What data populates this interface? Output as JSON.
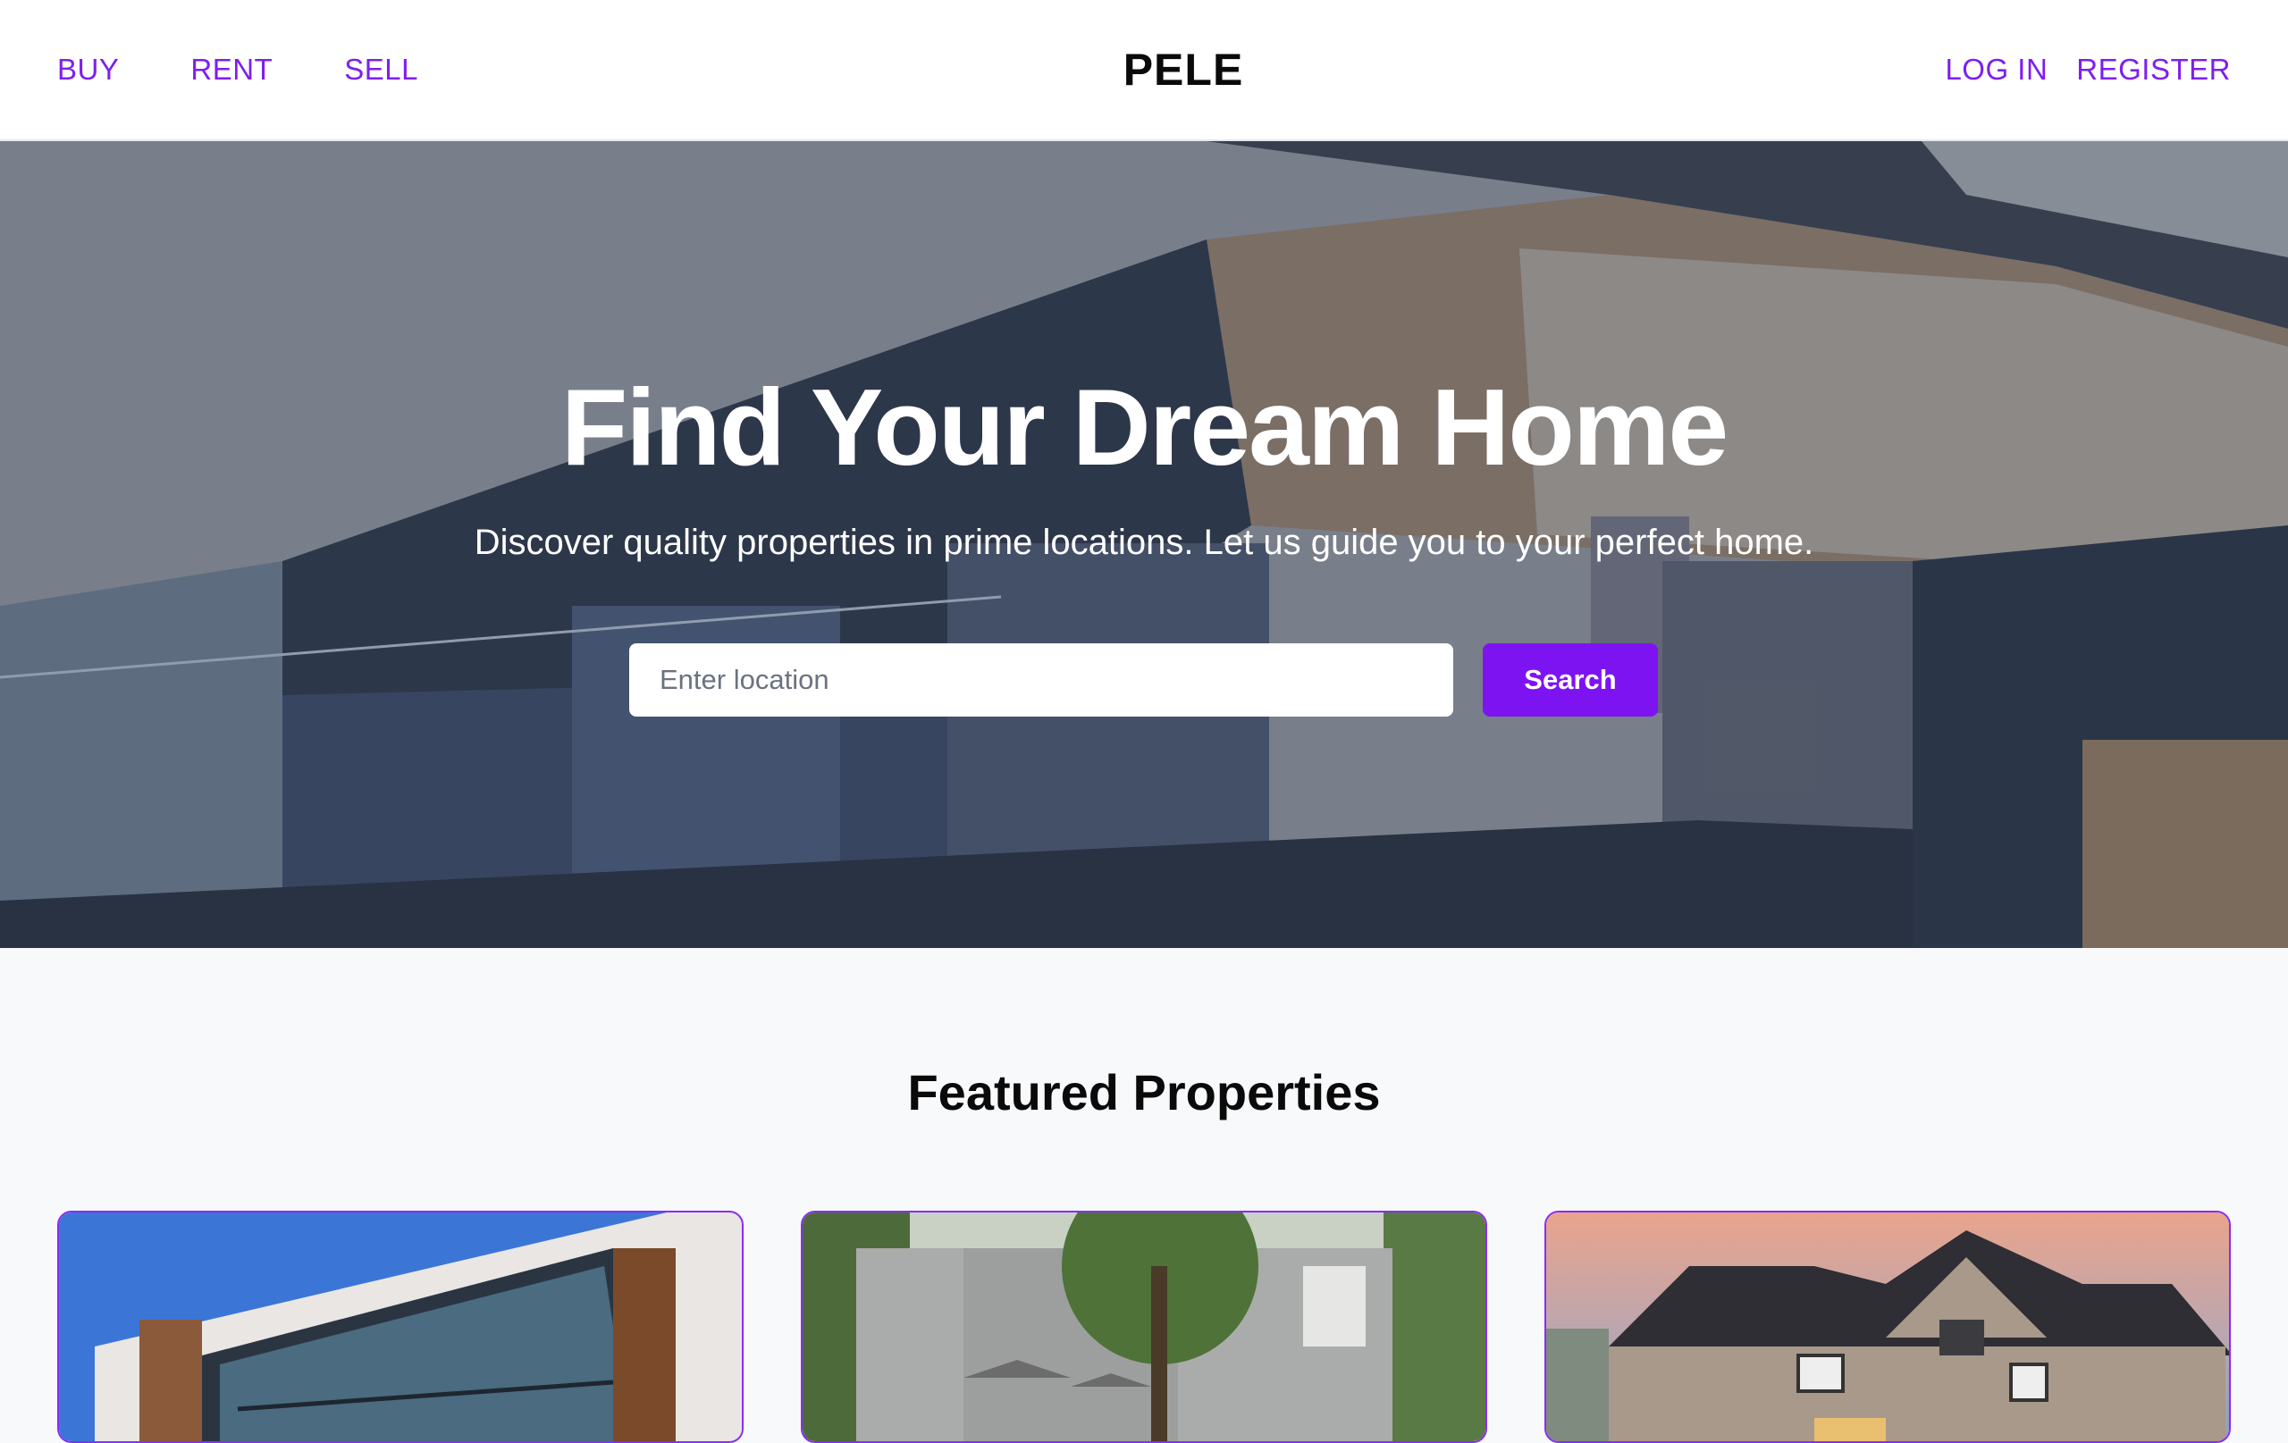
{
  "header": {
    "nav_left": [
      "BUY",
      "RENT",
      "SELL"
    ],
    "brand": "PELE",
    "nav_right": [
      "LOG IN",
      "REGISTER"
    ]
  },
  "hero": {
    "title": "Find Your Dream Home",
    "subtitle": "Discover quality properties in prime locations. Let us guide you to your perfect home.",
    "search_placeholder": "Enter location",
    "search_button": "Search"
  },
  "featured": {
    "title": "Featured Properties"
  },
  "colors": {
    "accent": "#7e13f2",
    "nav_link": "#7e1ef0",
    "card_border": "#8b2cf5",
    "page_bg": "#f8f9fb"
  }
}
